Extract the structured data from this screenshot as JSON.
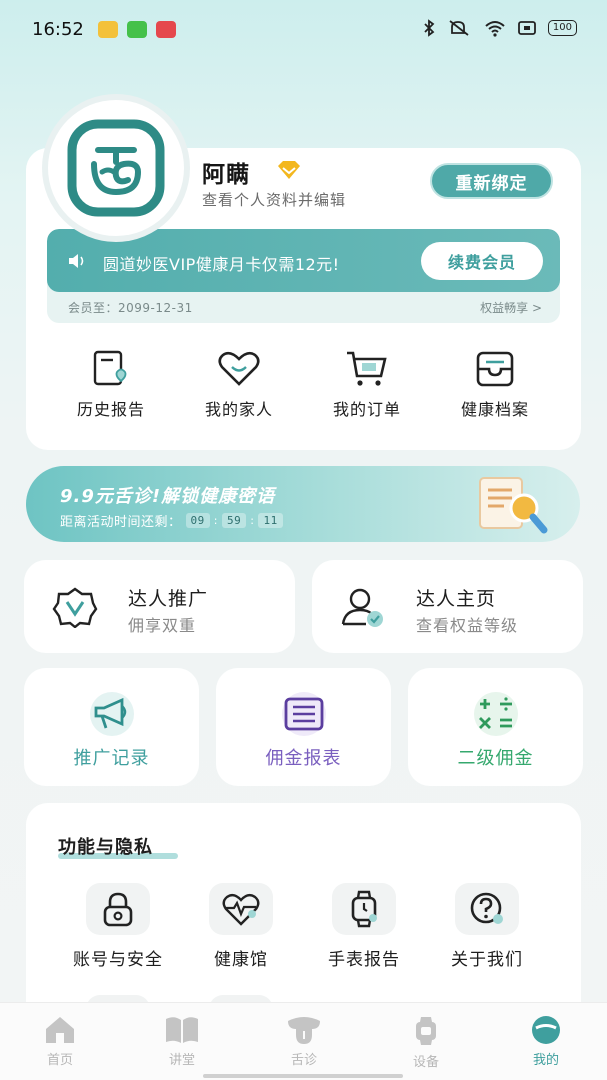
{
  "status_bar": {
    "time": "16:52",
    "battery": "100",
    "icons": [
      "bluetooth-icon",
      "mute-icon",
      "wifi-icon",
      "sim-icon",
      "battery-icon"
    ]
  },
  "profile": {
    "name": "阿瞒",
    "subtitle": "查看个人资料并编辑",
    "rebind_label": "重新绑定"
  },
  "vip": {
    "message": "圆道妙医VIP健康月卡仅需12元!",
    "renew_label": "续费会员",
    "expire": "会员至：2099-12-31",
    "benefit": "权益畅享 >"
  },
  "quick_actions": [
    {
      "label": "历史报告",
      "icon": "report-icon"
    },
    {
      "label": "我的家人",
      "icon": "heart-icon"
    },
    {
      "label": "我的订单",
      "icon": "cart-icon"
    },
    {
      "label": "健康档案",
      "icon": "archive-icon"
    }
  ],
  "promo": {
    "title": "9.9元舌诊!解锁健康密语",
    "countdown_label": "距离活动时间还剩：",
    "hours": "09",
    "minutes": "59",
    "seconds": "11"
  },
  "talent": [
    {
      "title": "达人推广",
      "sub": "佣享双重",
      "icon": "badge-v-icon"
    },
    {
      "title": "达人主页",
      "sub": "查看权益等级",
      "icon": "user-badge-icon"
    }
  ],
  "tiles": [
    {
      "label": "推广记录",
      "icon": "megaphone-icon",
      "color": "#3f9f9e"
    },
    {
      "label": "佣金报表",
      "icon": "list-icon",
      "color": "#7a5fbf"
    },
    {
      "label": "二级佣金",
      "icon": "calculator-icon",
      "color": "#35a86e"
    }
  ],
  "functions": {
    "title": "功能与隐私",
    "items": [
      {
        "label": "账号与安全",
        "icon": "lock-icon"
      },
      {
        "label": "健康馆",
        "icon": "heartbeat-icon"
      },
      {
        "label": "手表报告",
        "icon": "watch-icon"
      },
      {
        "label": "关于我们",
        "icon": "question-icon"
      }
    ]
  },
  "nav": [
    {
      "label": "首页",
      "icon": "home-icon"
    },
    {
      "label": "讲堂",
      "icon": "book-icon"
    },
    {
      "label": "舌诊",
      "icon": "tongue-icon"
    },
    {
      "label": "设备",
      "icon": "device-icon"
    },
    {
      "label": "我的",
      "icon": "profile-icon",
      "active": true
    }
  ],
  "colors": {
    "accent": "#4fa9a8",
    "active_nav": "#3f9f9e"
  }
}
